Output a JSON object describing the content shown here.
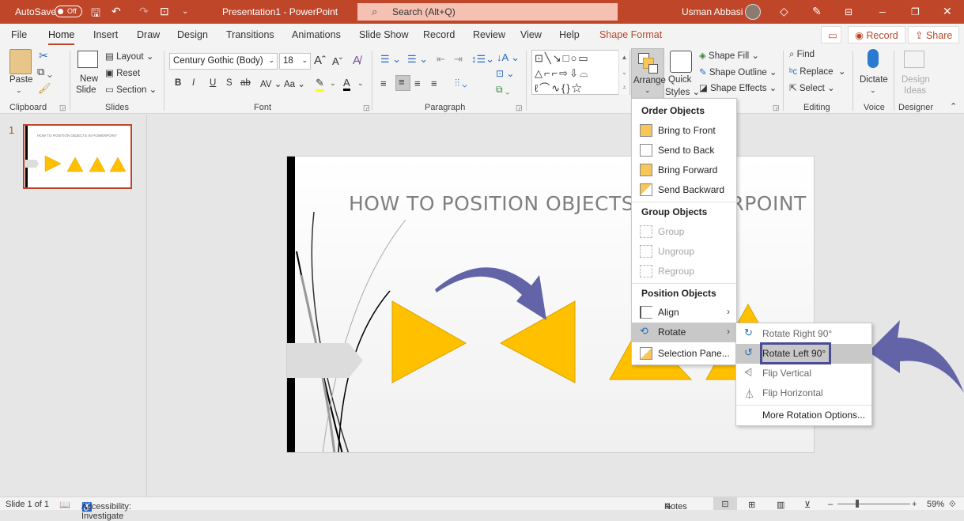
{
  "titlebar": {
    "autosave_label": "AutoSave",
    "autosave_state": "Off",
    "doc_title": "Presentation1  -  PowerPoint",
    "search_placeholder": "Search (Alt+Q)",
    "user_name": "Usman Abbasi",
    "icons": [
      "save-icon",
      "undo-icon",
      "redo-icon",
      "present-icon",
      "customize-icon",
      "diamond-icon",
      "pen-icon",
      "ribbon-display-icon",
      "minimize-icon",
      "restore-icon",
      "close-icon"
    ]
  },
  "tabs": [
    "File",
    "Home",
    "Insert",
    "Draw",
    "Design",
    "Transitions",
    "Animations",
    "Slide Show",
    "Record",
    "Review",
    "View",
    "Help",
    "Shape Format"
  ],
  "active_tab": "Home",
  "tab_actions": {
    "comments": "comment-icon",
    "record": "Record",
    "share": "Share"
  },
  "ribbon": {
    "clipboard": {
      "paste": "Paste",
      "label": "Clipboard"
    },
    "slides": {
      "new_slide_1": "New",
      "new_slide_2": "Slide",
      "layout": "Layout",
      "reset": "Reset",
      "section": "Section",
      "label": "Slides"
    },
    "font": {
      "family": "Century Gothic (Body)",
      "size": "18",
      "label": "Font",
      "buttons": [
        "B",
        "I",
        "U",
        "S",
        "ab",
        "AV",
        "Aa"
      ]
    },
    "paragraph": {
      "label": "Paragraph"
    },
    "drawing": {
      "arrange": "Arrange",
      "quick_styles_1": "Quick",
      "quick_styles_2": "Styles",
      "shape_fill": "Shape Fill",
      "shape_outline": "Shape Outline",
      "shape_effects": "Shape Effects"
    },
    "editing": {
      "find": "Find",
      "replace": "Replace",
      "select": "Select",
      "label": "Editing"
    },
    "voice": {
      "dictate": "Dictate",
      "label": "Voice"
    },
    "designer": {
      "ideas_1": "Design",
      "ideas_2": "Ideas",
      "label": "Designer"
    }
  },
  "thumbnail": {
    "number": "1",
    "title": "HOW TO POSITION OBJECTS  IN POWERPOINT"
  },
  "slide": {
    "title": "HOW TO POSITION OBJECTS  IN POWERPOINT",
    "shape_color": "#ffc000",
    "arrow_color": "#6264a7"
  },
  "arrange_menu": {
    "order_header": "Order Objects",
    "order_items": [
      "Bring to Front",
      "Send to Back",
      "Bring Forward",
      "Send Backward"
    ],
    "group_header": "Group Objects",
    "group_items": [
      "Group",
      "Ungroup",
      "Regroup"
    ],
    "position_header": "Position Objects",
    "position_items": [
      "Align",
      "Rotate",
      "Selection Pane..."
    ]
  },
  "rotate_menu": {
    "items": [
      "Rotate Right 90°",
      "Rotate Left 90°",
      "Flip Vertical",
      "Flip Horizontal",
      "More Rotation Options..."
    ],
    "highlighted": "Rotate Left 90°"
  },
  "status": {
    "slide": "Slide 1 of 1",
    "accessibility": "Accessibility: Investigate",
    "notes": "Notes",
    "zoom": "59%",
    "zoom_level_percent": 59
  }
}
